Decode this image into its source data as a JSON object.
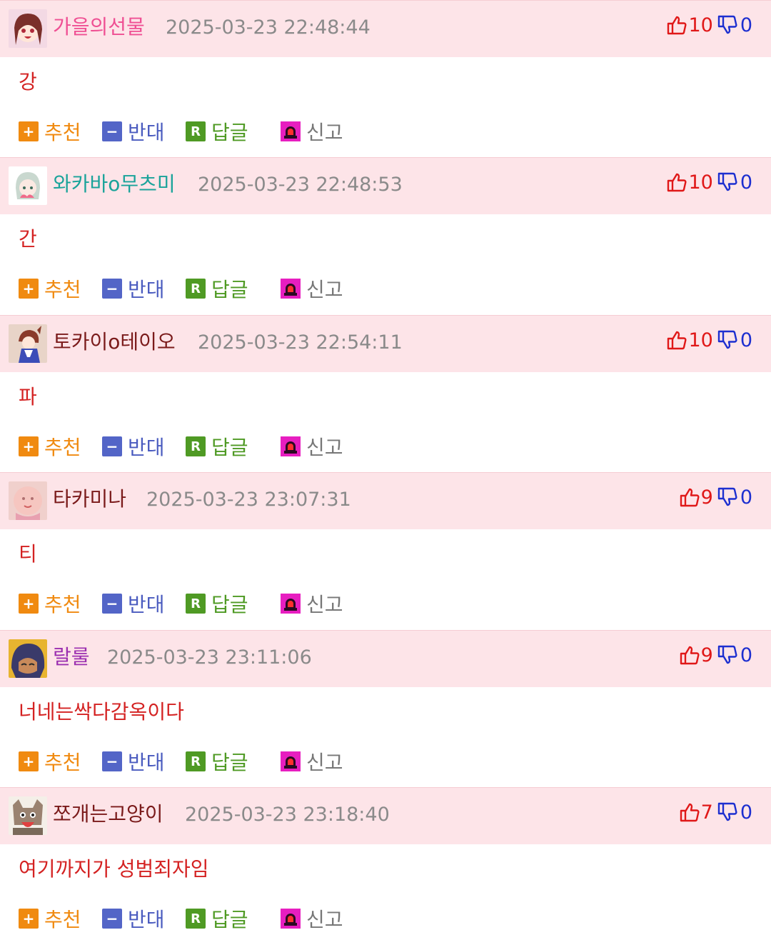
{
  "colors": {
    "header_bg": "#fde4e8",
    "body_text": "#d42222",
    "upvote": "#e01818",
    "downvote": "#1d2fd0",
    "recommend": "#f08a10",
    "oppose": "#4a5bbf",
    "reply": "#4f9a24",
    "report": "#777777"
  },
  "actions": {
    "recommend_label": "추천",
    "oppose_label": "반대",
    "reply_label": "답글",
    "report_label": "신고",
    "recommend_icon": "+",
    "oppose_icon": "−",
    "reply_icon": "R"
  },
  "comments": [
    {
      "author": "가을의선물",
      "author_color": "#ef4f93",
      "date": "2025-03-23 22:48:44",
      "up": "10",
      "down": "0",
      "text": "강"
    },
    {
      "author": "와카바o무츠미",
      "author_color": "#1aa39a",
      "date": "2025-03-23 22:48:53",
      "up": "10",
      "down": "0",
      "text": "간"
    },
    {
      "author": "토카이o테이오",
      "author_color": "#7a1a1a",
      "date": "2025-03-23 22:54:11",
      "up": "10",
      "down": "0",
      "text": "파"
    },
    {
      "author": "타카미나",
      "author_color": "#7a1a1a",
      "date": "2025-03-23 23:07:31",
      "up": "9",
      "down": "0",
      "text": "티"
    },
    {
      "author": "랄룰",
      "author_color": "#9b2fb0",
      "date": "2025-03-23 23:11:06",
      "up": "9",
      "down": "0",
      "text": "너네는싹다감옥이다"
    },
    {
      "author": "쪼개는고양이",
      "author_color": "#7a1a1a",
      "date": "2025-03-23 23:18:40",
      "up": "7",
      "down": "0",
      "text": "여기까지가 성범죄자임"
    }
  ]
}
